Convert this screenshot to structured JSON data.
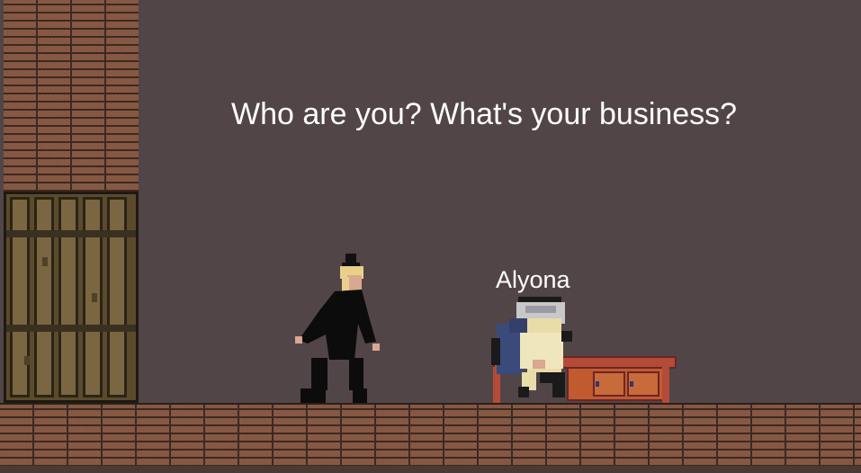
{
  "dialogue": {
    "text": "Who are you? What's your business?"
  },
  "npc": {
    "name": "Alyona"
  },
  "colors": {
    "background": "#524547",
    "brick": "#8a5a44",
    "door_wood": "#7a6640",
    "text": "#ffffff"
  }
}
